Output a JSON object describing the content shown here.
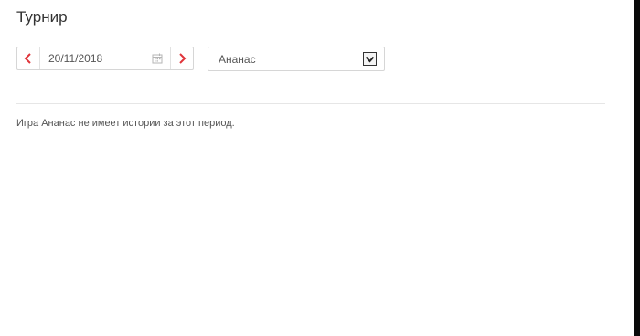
{
  "page": {
    "title": "Турнир",
    "message": "Игра Ананас не имеет истории за этот период."
  },
  "filters": {
    "date_value": "20/11/2018",
    "game_selected": "Ананас"
  },
  "colors": {
    "accent": "#e0343a",
    "border": "#d6d6d6",
    "text": "#333333"
  },
  "icons": {
    "prev": "chevron-left-icon",
    "next": "chevron-right-icon",
    "calendar": "calendar-icon",
    "dropdown": "chevron-down-icon"
  }
}
